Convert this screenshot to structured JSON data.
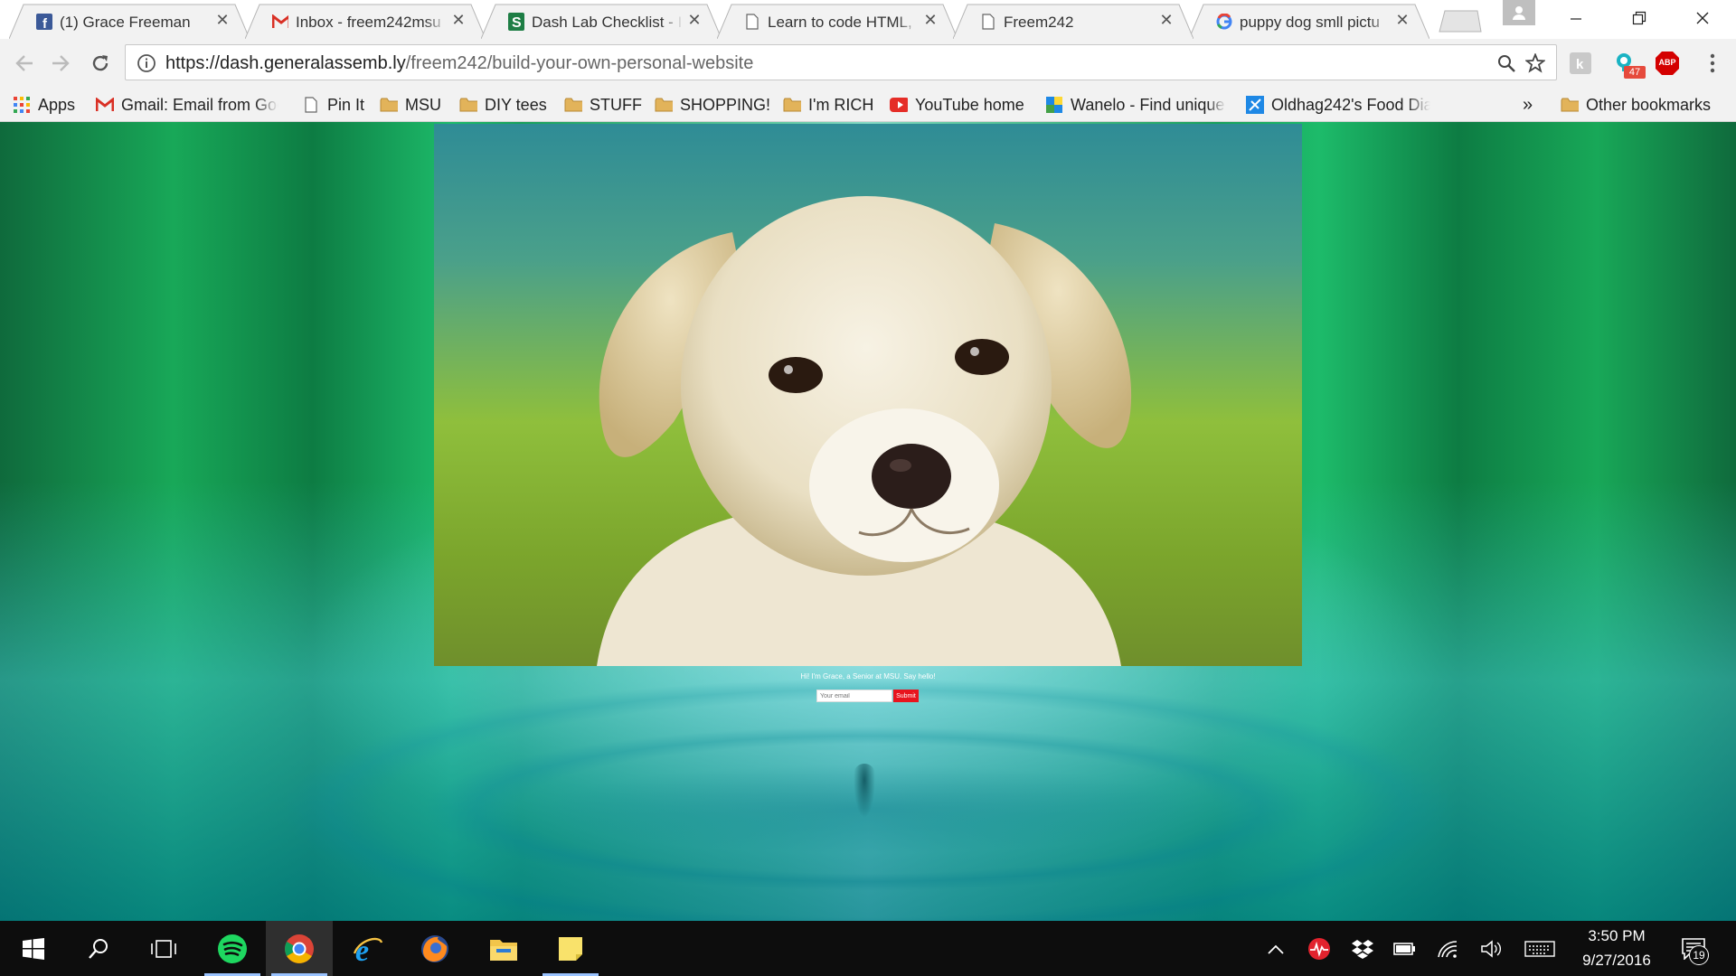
{
  "browser": {
    "tabs": [
      {
        "title": "(1) Grace Freeman",
        "icon": "facebook-icon",
        "active": false
      },
      {
        "title": "Inbox - freem242msu",
        "icon": "gmail-icon",
        "active": false
      },
      {
        "title": "Dash Lab Checklist - I",
        "icon": "sheets-s-icon",
        "active": false
      },
      {
        "title": "Learn to code HTML,",
        "icon": "page-icon",
        "active": false
      },
      {
        "title": "Freem242",
        "icon": "page-icon",
        "active": true
      },
      {
        "title": "puppy dog smll pictu",
        "icon": "google-icon",
        "active": false
      }
    ],
    "tab_close_glyph": "✕",
    "address_bar": {
      "host": "https://dash.generalassemb.ly",
      "path": "/freem242/build-your-own-personal-website"
    },
    "extension_badge": "47",
    "adblock_label": "ABP"
  },
  "bookmarks": {
    "items": [
      {
        "label": "Apps",
        "icon": "apps-grid-icon"
      },
      {
        "label": "Gmail: Email from Goo",
        "icon": "gmail-icon"
      },
      {
        "label": "Pin It",
        "icon": "page-icon"
      },
      {
        "label": "MSU",
        "icon": "folder-icon"
      },
      {
        "label": "DIY tees",
        "icon": "folder-icon"
      },
      {
        "label": "STUFF",
        "icon": "folder-icon"
      },
      {
        "label": "SHOPPING!",
        "icon": "folder-icon"
      },
      {
        "label": "I'm RICH",
        "icon": "folder-icon"
      },
      {
        "label": "YouTube home",
        "icon": "youtube-icon"
      },
      {
        "label": "Wanelo - Find unique",
        "icon": "wanelo-icon"
      },
      {
        "label": "Oldhag242's Food Dia",
        "icon": "food-diary-icon"
      }
    ],
    "overflow": "»",
    "other": "Other bookmarks"
  },
  "page": {
    "intro_text": "Hi! I'm Grace, a Senior at MSU. Say hello!",
    "email_placeholder": "Your email",
    "submit_label": "Submit"
  },
  "taskbar": {
    "apps": [
      "start-windows-icon",
      "search-icon",
      "task-view-icon",
      "spotify-icon",
      "chrome-icon",
      "internet-explorer-icon",
      "firefox-icon",
      "file-explorer-icon",
      "sticky-notes-icon"
    ],
    "clock_time": "3:50 PM",
    "clock_date": "9/27/2016",
    "notification_count": "19"
  },
  "colors": {
    "accent_submit": "#e8141e",
    "taskbar": "#0d0d0d",
    "toolbar": "#f2f2f2"
  }
}
